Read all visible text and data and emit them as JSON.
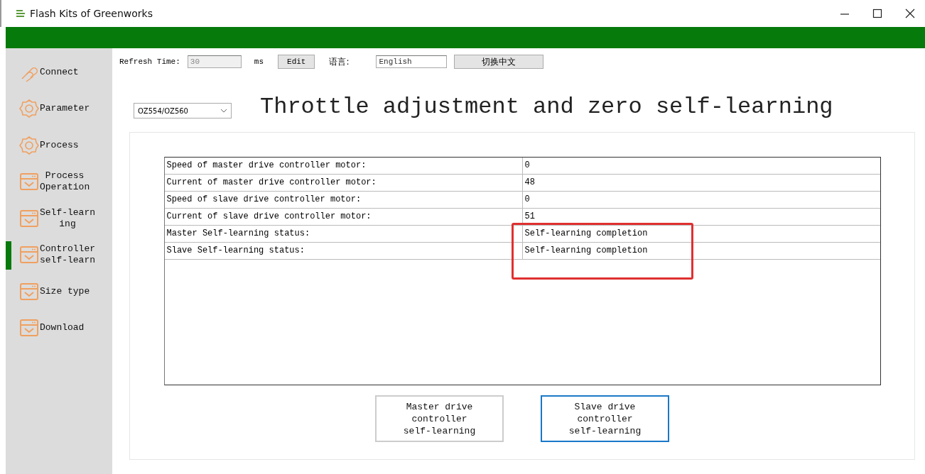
{
  "window": {
    "title": "Flash Kits of Greenworks"
  },
  "sidebar": {
    "items": [
      {
        "label": "Connect",
        "kind": "link",
        "selected": false
      },
      {
        "label": "Parameter",
        "kind": "gear",
        "selected": false
      },
      {
        "label": "Process",
        "kind": "gear",
        "selected": false
      },
      {
        "label": "Process\nOperation",
        "kind": "window",
        "selected": false
      },
      {
        "label": "Self-learn\ning",
        "kind": "window",
        "selected": false
      },
      {
        "label": "Controller\nself-learn",
        "kind": "window",
        "selected": true
      },
      {
        "label": "Size type",
        "kind": "window",
        "selected": false
      },
      {
        "label": "Download",
        "kind": "window",
        "selected": false
      }
    ]
  },
  "toolbar": {
    "refresh_label": "Refresh Time:",
    "refresh_value": "30",
    "refresh_disabled": true,
    "unit": "ms",
    "edit_button": "Edit",
    "language_label": "语言:",
    "language_value": "English",
    "switch_button": "切换中文"
  },
  "model_select": {
    "value": "OZ554/OZ560"
  },
  "heading": "Throttle adjustment and zero self-learning",
  "table": {
    "rows": [
      {
        "label": "Speed of master drive controller motor:",
        "value": "0"
      },
      {
        "label": "Current of master drive controller motor:",
        "value": "48"
      },
      {
        "label": "Speed of slave drive controller motor:",
        "value": "0"
      },
      {
        "label": "Current of slave drive controller motor:",
        "value": "51"
      },
      {
        "label": "Master Self-learning status:",
        "value": "Self-learning completion"
      },
      {
        "label": "Slave Self-learning status:",
        "value": "Self-learning completion"
      }
    ]
  },
  "buttons": [
    {
      "label": "Master drive\ncontroller\nself-learning",
      "focused": false
    },
    {
      "label": "Slave drive\ncontroller\nself-learning",
      "focused": true
    }
  ]
}
